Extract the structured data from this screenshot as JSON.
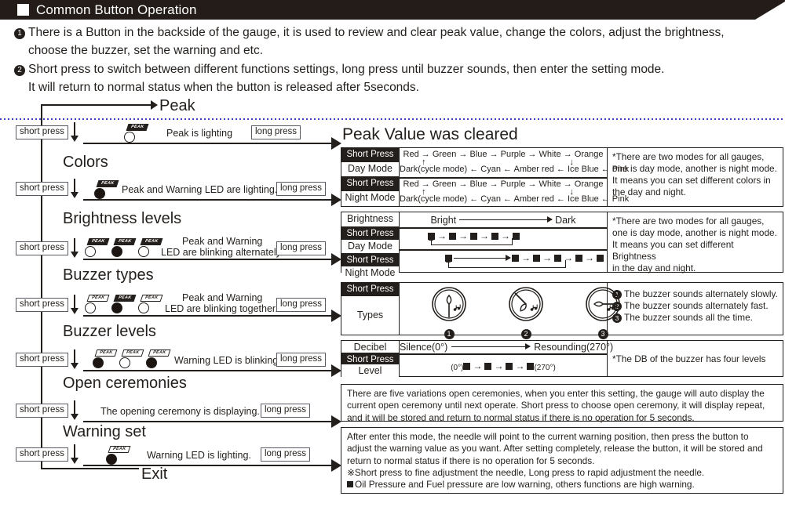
{
  "header": {
    "checkbox_icon": "white-square-icon",
    "title": "Common Button Operation"
  },
  "intro": {
    "item1_num": "1",
    "item1_line1": "There is a Button in the backside of the gauge, it is used to review and clear peak value, change the colors, adjust the brightness,",
    "item1_line2": "choose the buzzer, set the warning and etc.",
    "item2_num": "2",
    "item2_line1": "Short press to switch between different functions settings,  long press until buzzer sounds, then enter the setting mode.",
    "item2_line2": "It will return to normal status when the button is released after 5seconds."
  },
  "flow": {
    "start_label": "Peak",
    "exit_label": "Exit",
    "short_press": "short press",
    "long_press": "long press",
    "sections": [
      {
        "title": "Peak",
        "caption": "Peak is lighting"
      },
      {
        "title": "Colors",
        "caption": "Peak and Warning LED are lighting."
      },
      {
        "title": "Brightness levels",
        "caption_line1": "Peak and Warning",
        "caption_line2": "LED are blinking alternately"
      },
      {
        "title": "Buzzer types",
        "caption_line1": "Peak and Warning",
        "caption_line2": "LED are blinking together."
      },
      {
        "title": "Buzzer levels",
        "caption": "Warning LED is blinking."
      },
      {
        "title": "Open ceremonies",
        "caption": "The opening ceremony is displaying."
      },
      {
        "title": "Warning set",
        "caption": "Warning LED is lighting."
      }
    ],
    "led_badge_label": "PEAK"
  },
  "peak_result": {
    "heading": "Peak Value was cleared"
  },
  "colors_panel": {
    "rows": [
      {
        "press": "Short Press",
        "mode": "Day Mode"
      },
      {
        "press": "Short Press",
        "mode": "Night Mode"
      }
    ],
    "top_sequence": "Red  →  Green → Blue → Purple → White → Orange",
    "bottom_sequence": "Dark(cycle mode) ← Cyan ← Amber red ←  Ice Blue ← Pink",
    "note_line1": "*There are two modes for all gauges,",
    "note_line2": "one is day mode, another is night mode.",
    "note_line3": "It means you can set different colors in",
    "note_line4": "the day and night."
  },
  "brightness_panel": {
    "label": "Brightness",
    "bright_label": "Bright",
    "dark_label": "Dark",
    "rows": [
      {
        "press": "Short Press",
        "mode": "Day Mode",
        "squares": 5
      },
      {
        "press": "Short Press",
        "mode": "Night Mode",
        "squares": 5
      }
    ],
    "note_line1": "*There are two modes for all gauges,",
    "note_line2": "one is day mode, another is night mode.",
    "note_line3": "It means you can set different Brightness",
    "note_line4": "in the day and night."
  },
  "buzzer_types_panel": {
    "press": "Short Press",
    "types_label": "Types",
    "gauges": [
      {
        "num": "1",
        "needle": "down"
      },
      {
        "num": "2",
        "needle": "upleft"
      },
      {
        "num": "3",
        "needle": "right"
      }
    ],
    "notes": [
      {
        "num": "1",
        "text": "The buzzer sounds alternately slowly."
      },
      {
        "num": "2",
        "text": "The buzzer sounds alternately fast."
      },
      {
        "num": "3",
        "text": "The buzzer sounds all the time."
      }
    ]
  },
  "buzzer_levels_panel": {
    "decibel_label": "Decibel",
    "press": "Short Press",
    "level_label": "Level",
    "silence_label": "Silence(0°)",
    "resounding_label": "Resounding(270°)",
    "seq_start": "(0°)",
    "seq_end": "(270°)",
    "squares": 4,
    "note": "*The DB of the buzzer has four levels"
  },
  "open_ceremonies_panel": {
    "line1": "There are five variations open ceremonies, when you enter this setting, the gauge will auto display the",
    "line2": "current open ceremony until next operate. Short press to choose open ceremony, it will display repeat,",
    "line3": "and it will be stored and return to normal status if there is no operation for 5 seconds."
  },
  "warning_set_panel": {
    "line1": "After enter this mode, the needle will point to the current warning position, then press the button to",
    "line2": "adjust the warning value as you want. After setting completely, release the button, it will be stored and",
    "line3": "return to normal status if there is no operation for 5 seconds.",
    "line4": "※Short press to fine adjustment the needle, Long press to rapid adjustment the needle.",
    "line5": "Oil Pressure and Fuel pressure are low warning, others functions are high warning."
  },
  "colors": {
    "ink": "#231f1c",
    "dotted_divider": "#3b3bd0",
    "panel_border": "#231f1c",
    "box_border": "#5a5a62"
  }
}
